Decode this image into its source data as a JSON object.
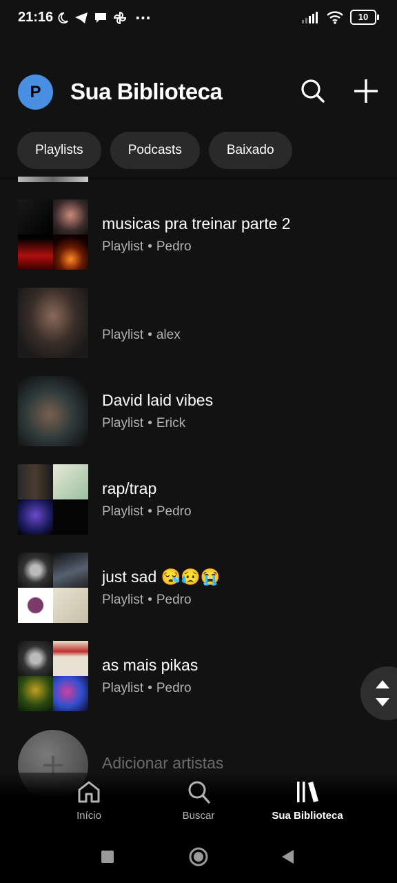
{
  "status_bar": {
    "time": "21:16",
    "battery": "10",
    "more": "···"
  },
  "header": {
    "avatar_letter": "P",
    "title": "Sua Biblioteca"
  },
  "filters": [
    "Playlists",
    "Podcasts",
    "Baixado"
  ],
  "items": [
    {
      "title": "musicas pra treinar parte 2",
      "type": "Playlist",
      "owner": "Pedro"
    },
    {
      "title": "",
      "type": "Playlist",
      "owner": "alex"
    },
    {
      "title": "David laid vibes",
      "type": "Playlist",
      "owner": "Erick"
    },
    {
      "title": "rap/trap",
      "type": "Playlist",
      "owner": "Pedro"
    },
    {
      "title": "just sad 😪😥😭",
      "type": "Playlist",
      "owner": "Pedro"
    },
    {
      "title": "as mais pikas",
      "type": "Playlist",
      "owner": "Pedro"
    }
  ],
  "add_artists": {
    "icon": "+",
    "label": "Adicionar artistas"
  },
  "bottom_nav": [
    {
      "label": "Início",
      "icon": "home-icon"
    },
    {
      "label": "Buscar",
      "icon": "search-icon"
    },
    {
      "label": "Sua Biblioteca",
      "icon": "library-icon",
      "active": true
    }
  ],
  "colors": {
    "background": "#121212",
    "chip": "#2a2a2a",
    "subtext": "#b3b3b3",
    "avatar": "#4a90e2"
  }
}
